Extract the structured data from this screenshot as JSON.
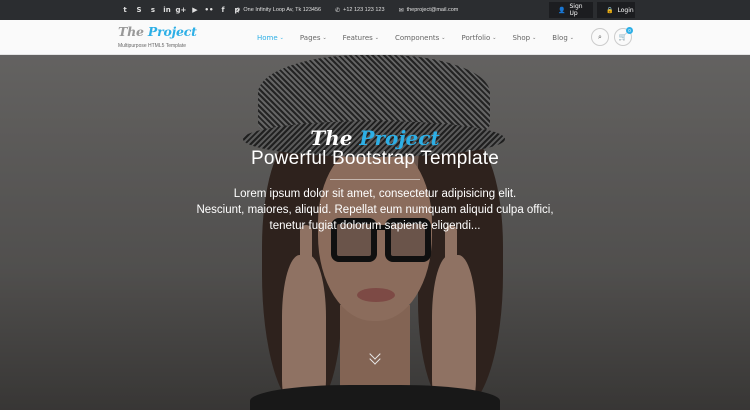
{
  "topbar": {
    "social": [
      "𝕥",
      "ϐ",
      "S",
      "in",
      "g+",
      "▶",
      "●",
      "f",
      "℗"
    ],
    "address": "One Infinity Loop Av, Tk 123456",
    "phone": "+12 123 123 123",
    "email": "theproject@mail.com",
    "signup_label": "Sign Up",
    "login_label": "Login"
  },
  "header": {
    "logo_the": "The ",
    "logo_project": "Project",
    "tagline": "Multipurpose HTML5 Template",
    "nav": [
      {
        "label": "Home"
      },
      {
        "label": "Pages"
      },
      {
        "label": "Features"
      },
      {
        "label": "Components"
      },
      {
        "label": "Portfolio"
      },
      {
        "label": "Shop"
      },
      {
        "label": "Blog"
      }
    ],
    "cart_count": "0"
  },
  "hero": {
    "brand_the": "The ",
    "brand_project": "Project",
    "title": "Powerful Bootstrap Template",
    "desc_line1": "Lorem ipsum dolor sit amet, consectetur adipisicing elit.",
    "desc_line2": "Nesciunt, maiores, aliquid. Repellat eum numquam aliquid culpa offici,",
    "desc_line3": "tenetur fugiat dolorum sapiente eligendi..."
  },
  "colors": {
    "accent": "#2dafe6",
    "topbar_bg": "#2b2d30",
    "header_bg": "#fafafa"
  }
}
